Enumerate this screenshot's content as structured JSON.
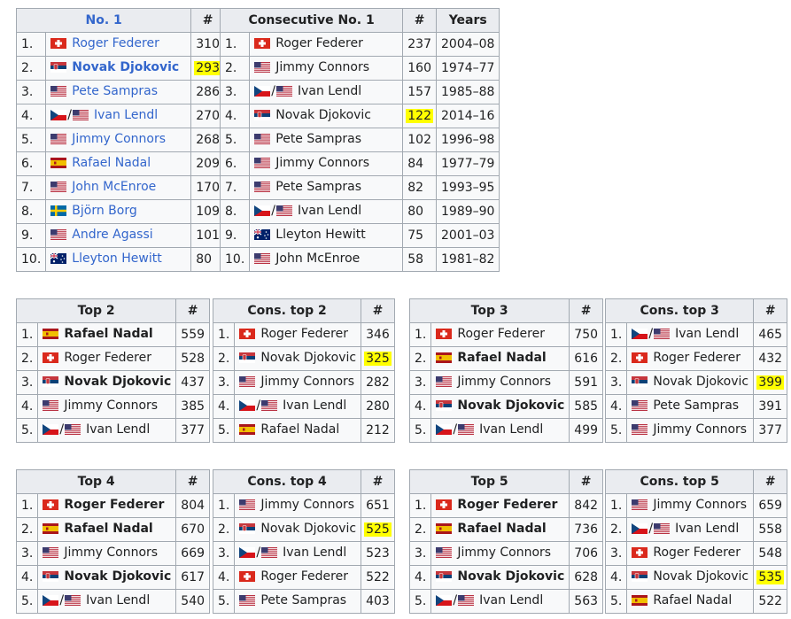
{
  "tables": [
    {
      "id": "no1",
      "title": "No. 1",
      "title_link": true,
      "count_header": "#",
      "rows": [
        {
          "rank": "1.",
          "flags": [
            "sui"
          ],
          "name": "Roger Federer",
          "link": true,
          "bold": false,
          "value": "310",
          "highlight": false
        },
        {
          "rank": "2.",
          "flags": [
            "srb"
          ],
          "name": "Novak Djokovic",
          "link": true,
          "bold": true,
          "value": "293",
          "highlight": true
        },
        {
          "rank": "3.",
          "flags": [
            "usa"
          ],
          "name": "Pete Sampras",
          "link": true,
          "bold": false,
          "value": "286",
          "highlight": false
        },
        {
          "rank": "4.",
          "flags": [
            "cze",
            "usa"
          ],
          "name": "Ivan Lendl",
          "link": true,
          "bold": false,
          "value": "270",
          "highlight": false
        },
        {
          "rank": "5.",
          "flags": [
            "usa"
          ],
          "name": "Jimmy Connors",
          "link": true,
          "bold": false,
          "value": "268",
          "highlight": false
        },
        {
          "rank": "6.",
          "flags": [
            "esp"
          ],
          "name": "Rafael Nadal",
          "link": true,
          "bold": false,
          "value": "209",
          "highlight": false
        },
        {
          "rank": "7.",
          "flags": [
            "usa"
          ],
          "name": "John McEnroe",
          "link": true,
          "bold": false,
          "value": "170",
          "highlight": false
        },
        {
          "rank": "8.",
          "flags": [
            "swe"
          ],
          "name": "Björn Borg",
          "link": true,
          "bold": false,
          "value": "109",
          "highlight": false
        },
        {
          "rank": "9.",
          "flags": [
            "usa"
          ],
          "name": "Andre Agassi",
          "link": true,
          "bold": false,
          "value": "101",
          "highlight": false
        },
        {
          "rank": "10.",
          "flags": [
            "aus"
          ],
          "name": "Lleyton Hewitt",
          "link": true,
          "bold": false,
          "value": "80",
          "highlight": false
        }
      ]
    },
    {
      "id": "consecutive-no1",
      "title": "Consecutive No. 1",
      "title_link": false,
      "count_header": "#",
      "years_header": "Years",
      "rows": [
        {
          "rank": "1.",
          "flags": [
            "sui"
          ],
          "name": "Roger Federer",
          "value": "237",
          "years": "2004–08",
          "highlight": false
        },
        {
          "rank": "2.",
          "flags": [
            "usa"
          ],
          "name": "Jimmy Connors",
          "value": "160",
          "years": "1974–77",
          "highlight": false
        },
        {
          "rank": "3.",
          "flags": [
            "cze",
            "usa"
          ],
          "name": "Ivan Lendl",
          "value": "157",
          "years": "1985–88",
          "highlight": false
        },
        {
          "rank": "4.",
          "flags": [
            "srb"
          ],
          "name": "Novak Djokovic",
          "value": "122",
          "years": "2014–16",
          "highlight": true
        },
        {
          "rank": "5.",
          "flags": [
            "usa"
          ],
          "name": "Pete Sampras",
          "value": "102",
          "years": "1996–98",
          "highlight": false
        },
        {
          "rank": "6.",
          "flags": [
            "usa"
          ],
          "name": "Jimmy Connors",
          "value": "84",
          "years": "1977–79",
          "highlight": false
        },
        {
          "rank": "7.",
          "flags": [
            "usa"
          ],
          "name": "Pete Sampras",
          "value": "82",
          "years": "1993–95",
          "highlight": false
        },
        {
          "rank": "8.",
          "flags": [
            "cze",
            "usa"
          ],
          "name": "Ivan Lendl",
          "value": "80",
          "years": "1989–90",
          "highlight": false
        },
        {
          "rank": "9.",
          "flags": [
            "aus"
          ],
          "name": "Lleyton Hewitt",
          "value": "75",
          "years": "2001–03",
          "highlight": false
        },
        {
          "rank": "10.",
          "flags": [
            "usa"
          ],
          "name": "John McEnroe",
          "value": "58",
          "years": "1981–82",
          "highlight": false
        }
      ]
    },
    {
      "id": "top2",
      "title": "Top 2",
      "count_header": "#",
      "rows": [
        {
          "rank": "1.",
          "flags": [
            "esp"
          ],
          "name": "Rafael Nadal",
          "bold": true,
          "value": "559",
          "highlight": false
        },
        {
          "rank": "2.",
          "flags": [
            "sui"
          ],
          "name": "Roger Federer",
          "bold": false,
          "value": "528",
          "highlight": false
        },
        {
          "rank": "3.",
          "flags": [
            "srb"
          ],
          "name": "Novak Djokovic",
          "bold": true,
          "value": "437",
          "highlight": false
        },
        {
          "rank": "4.",
          "flags": [
            "usa"
          ],
          "name": "Jimmy Connors",
          "bold": false,
          "value": "385",
          "highlight": false
        },
        {
          "rank": "5.",
          "flags": [
            "cze",
            "usa"
          ],
          "name": "Ivan Lendl",
          "bold": false,
          "value": "377",
          "highlight": false
        }
      ]
    },
    {
      "id": "cons-top2",
      "title": "Cons. top 2",
      "count_header": "#",
      "rows": [
        {
          "rank": "1.",
          "flags": [
            "sui"
          ],
          "name": "Roger Federer",
          "bold": false,
          "value": "346",
          "highlight": false
        },
        {
          "rank": "2.",
          "flags": [
            "srb"
          ],
          "name": "Novak Djokovic",
          "bold": false,
          "value": "325",
          "highlight": true
        },
        {
          "rank": "3.",
          "flags": [
            "usa"
          ],
          "name": "Jimmy Connors",
          "bold": false,
          "value": "282",
          "highlight": false
        },
        {
          "rank": "4.",
          "flags": [
            "cze",
            "usa"
          ],
          "name": "Ivan Lendl",
          "bold": false,
          "value": "280",
          "highlight": false
        },
        {
          "rank": "5.",
          "flags": [
            "esp"
          ],
          "name": "Rafael Nadal",
          "bold": false,
          "value": "212",
          "highlight": false
        }
      ]
    },
    {
      "id": "top3",
      "title": "Top 3",
      "count_header": "#",
      "rows": [
        {
          "rank": "1.",
          "flags": [
            "sui"
          ],
          "name": "Roger Federer",
          "bold": false,
          "value": "750",
          "highlight": false
        },
        {
          "rank": "2.",
          "flags": [
            "esp"
          ],
          "name": "Rafael Nadal",
          "bold": true,
          "value": "616",
          "highlight": false
        },
        {
          "rank": "3.",
          "flags": [
            "usa"
          ],
          "name": "Jimmy Connors",
          "bold": false,
          "value": "591",
          "highlight": false
        },
        {
          "rank": "4.",
          "flags": [
            "srb"
          ],
          "name": "Novak Djokovic",
          "bold": true,
          "value": "585",
          "highlight": false
        },
        {
          "rank": "5.",
          "flags": [
            "cze",
            "usa"
          ],
          "name": "Ivan Lendl",
          "bold": false,
          "value": "499",
          "highlight": false
        }
      ]
    },
    {
      "id": "cons-top3",
      "title": "Cons. top 3",
      "count_header": "#",
      "rows": [
        {
          "rank": "1.",
          "flags": [
            "cze",
            "usa"
          ],
          "name": "Ivan Lendl",
          "bold": false,
          "value": "465",
          "highlight": false
        },
        {
          "rank": "2.",
          "flags": [
            "sui"
          ],
          "name": "Roger Federer",
          "bold": false,
          "value": "432",
          "highlight": false
        },
        {
          "rank": "3.",
          "flags": [
            "srb"
          ],
          "name": "Novak Djokovic",
          "bold": false,
          "value": "399",
          "highlight": true
        },
        {
          "rank": "4.",
          "flags": [
            "usa"
          ],
          "name": "Pete Sampras",
          "bold": false,
          "value": "391",
          "highlight": false
        },
        {
          "rank": "5.",
          "flags": [
            "usa"
          ],
          "name": "Jimmy Connors",
          "bold": false,
          "value": "377",
          "highlight": false
        }
      ]
    },
    {
      "id": "top4",
      "title": "Top 4",
      "count_header": "#",
      "rows": [
        {
          "rank": "1.",
          "flags": [
            "sui"
          ],
          "name": "Roger Federer",
          "bold": true,
          "value": "804",
          "highlight": false
        },
        {
          "rank": "2.",
          "flags": [
            "esp"
          ],
          "name": "Rafael Nadal",
          "bold": true,
          "value": "670",
          "highlight": false
        },
        {
          "rank": "3.",
          "flags": [
            "usa"
          ],
          "name": "Jimmy Connors",
          "bold": false,
          "value": "669",
          "highlight": false
        },
        {
          "rank": "4.",
          "flags": [
            "srb"
          ],
          "name": "Novak Djokovic",
          "bold": true,
          "value": "617",
          "highlight": false
        },
        {
          "rank": "5.",
          "flags": [
            "cze",
            "usa"
          ],
          "name": "Ivan Lendl",
          "bold": false,
          "value": "540",
          "highlight": false
        }
      ]
    },
    {
      "id": "cons-top4",
      "title": "Cons. top 4",
      "count_header": "#",
      "rows": [
        {
          "rank": "1.",
          "flags": [
            "usa"
          ],
          "name": "Jimmy Connors",
          "bold": false,
          "value": "651",
          "highlight": false
        },
        {
          "rank": "2.",
          "flags": [
            "srb"
          ],
          "name": "Novak Djokovic",
          "bold": false,
          "value": "525",
          "highlight": true
        },
        {
          "rank": "3.",
          "flags": [
            "cze",
            "usa"
          ],
          "name": "Ivan Lendl",
          "bold": false,
          "value": "523",
          "highlight": false
        },
        {
          "rank": "4.",
          "flags": [
            "sui"
          ],
          "name": "Roger Federer",
          "bold": false,
          "value": "522",
          "highlight": false
        },
        {
          "rank": "5.",
          "flags": [
            "usa"
          ],
          "name": "Pete Sampras",
          "bold": false,
          "value": "403",
          "highlight": false
        }
      ]
    },
    {
      "id": "top5",
      "title": "Top 5",
      "count_header": "#",
      "rows": [
        {
          "rank": "1.",
          "flags": [
            "sui"
          ],
          "name": "Roger Federer",
          "bold": true,
          "value": "842",
          "highlight": false
        },
        {
          "rank": "2.",
          "flags": [
            "esp"
          ],
          "name": "Rafael Nadal",
          "bold": true,
          "value": "736",
          "highlight": false
        },
        {
          "rank": "3.",
          "flags": [
            "usa"
          ],
          "name": "Jimmy Connors",
          "bold": false,
          "value": "706",
          "highlight": false
        },
        {
          "rank": "4.",
          "flags": [
            "srb"
          ],
          "name": "Novak Djokovic",
          "bold": true,
          "value": "628",
          "highlight": false
        },
        {
          "rank": "5.",
          "flags": [
            "cze",
            "usa"
          ],
          "name": "Ivan Lendl",
          "bold": false,
          "value": "563",
          "highlight": false
        }
      ]
    },
    {
      "id": "cons-top5",
      "title": "Cons. top 5",
      "count_header": "#",
      "rows": [
        {
          "rank": "1.",
          "flags": [
            "usa"
          ],
          "name": "Jimmy Connors",
          "bold": false,
          "value": "659",
          "highlight": false
        },
        {
          "rank": "2.",
          "flags": [
            "cze",
            "usa"
          ],
          "name": "Ivan Lendl",
          "bold": false,
          "value": "558",
          "highlight": false
        },
        {
          "rank": "3.",
          "flags": [
            "sui"
          ],
          "name": "Roger Federer",
          "bold": false,
          "value": "548",
          "highlight": false
        },
        {
          "rank": "4.",
          "flags": [
            "srb"
          ],
          "name": "Novak Djokovic",
          "bold": false,
          "value": "535",
          "highlight": true
        },
        {
          "rank": "5.",
          "flags": [
            "esp"
          ],
          "name": "Rafael Nadal",
          "bold": false,
          "value": "522",
          "highlight": false
        }
      ]
    }
  ],
  "flag_icons": {
    "sui": "switzerland-flag-icon",
    "srb": "serbia-flag-icon",
    "usa": "usa-flag-icon",
    "cze": "czechoslovakia-flag-icon",
    "esp": "spain-flag-icon",
    "swe": "sweden-flag-icon",
    "aus": "australia-flag-icon"
  },
  "colors": {
    "link": "#3366cc",
    "highlight": "#ffff00",
    "header_bg": "#eaecf0",
    "border": "#a2a9b1",
    "cell_bg": "#f8f9fa"
  }
}
